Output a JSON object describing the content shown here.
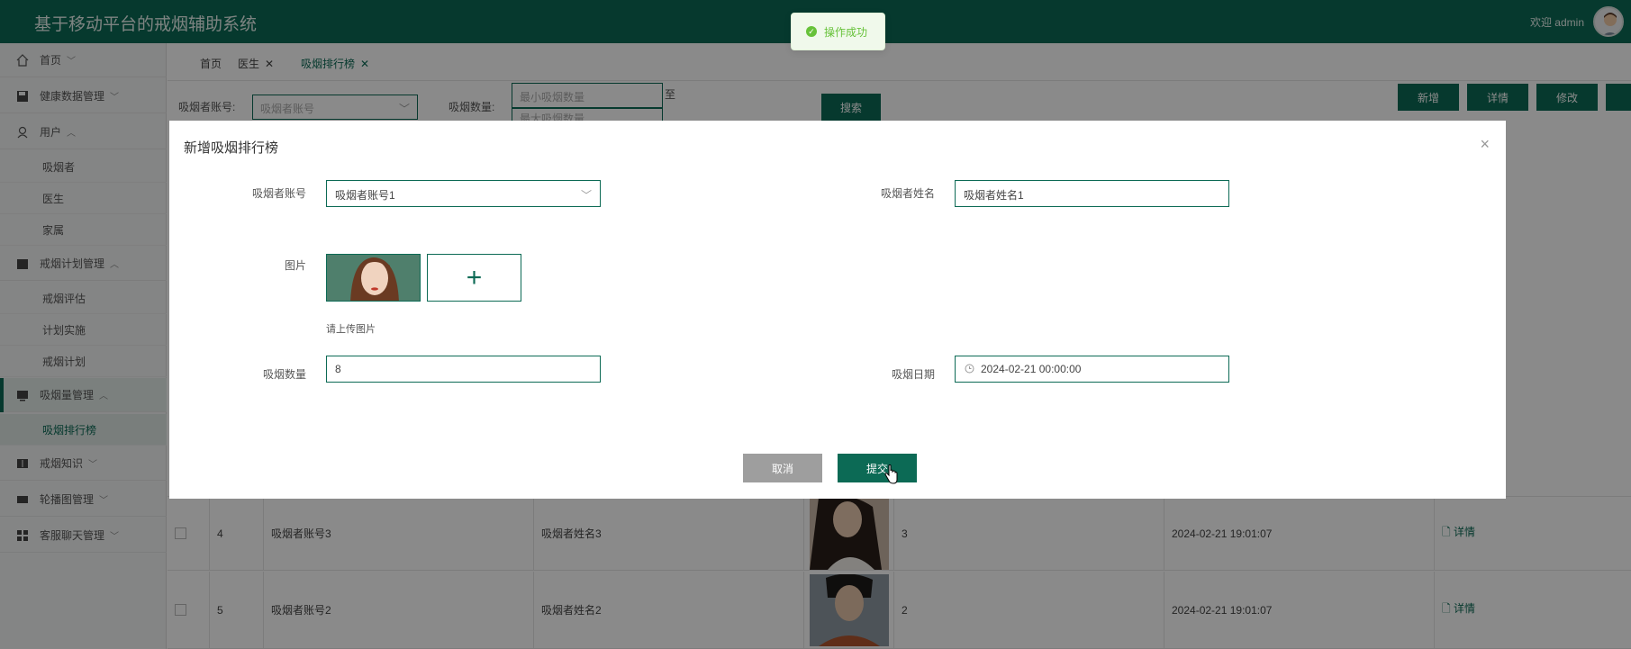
{
  "app": {
    "title": "基于移动平台的戒烟辅助系统",
    "welcome": "欢迎 admin"
  },
  "sidebar": {
    "home": "首页",
    "health": "健康数据管理",
    "users": "用户",
    "users_sub": [
      "吸烟者",
      "医生",
      "家属"
    ],
    "plan": "戒烟计划管理",
    "plan_sub": [
      "戒烟评估",
      "计划实施",
      "戒烟计划"
    ],
    "smoke": "吸烟量管理",
    "smoke_sub": [
      "吸烟排行榜"
    ],
    "knowledge": "戒烟知识",
    "carousel": "轮播图管理",
    "chat": "客服聊天管理"
  },
  "tabs": [
    "首页",
    "医生",
    "吸烟排行榜"
  ],
  "search": {
    "account_label": "吸烟者账号:",
    "account_placeholder": "吸烟者账号",
    "count_label": "吸烟数量:",
    "min_placeholder": "最小吸烟数量",
    "max_placeholder": "最大吸烟数量",
    "to_text": "至",
    "search_button": "搜索"
  },
  "toolbar": {
    "add": "新增",
    "detail": "详情",
    "edit": "修改"
  },
  "table": {
    "rows": [
      {
        "no": "4",
        "account": "吸烟者账号3",
        "name": "吸烟者姓名3",
        "count": "3",
        "date": "2024-02-21 19:01:07",
        "action": "详情"
      },
      {
        "no": "5",
        "account": "吸烟者账号2",
        "name": "吸烟者姓名2",
        "count": "2",
        "date": "2024-02-21 19:01:07",
        "action": "详情"
      }
    ]
  },
  "modal": {
    "title": "新增吸烟排行榜",
    "close": "×",
    "account_label": "吸烟者账号",
    "account_value": "吸烟者账号1",
    "name_label": "吸烟者姓名",
    "name_value": "吸烟者姓名1",
    "image_label": "图片",
    "upload_hint": "请上传图片",
    "count_label": "吸烟数量",
    "count_value": "8",
    "date_label": "吸烟日期",
    "date_value": "2024-02-21 00:00:00",
    "cancel": "取消",
    "submit": "提交"
  },
  "toast": {
    "message": "操作成功"
  },
  "colors": {
    "primary": "#0c6a55",
    "success": "#67c23a",
    "cancel": "#9e9e9e"
  }
}
